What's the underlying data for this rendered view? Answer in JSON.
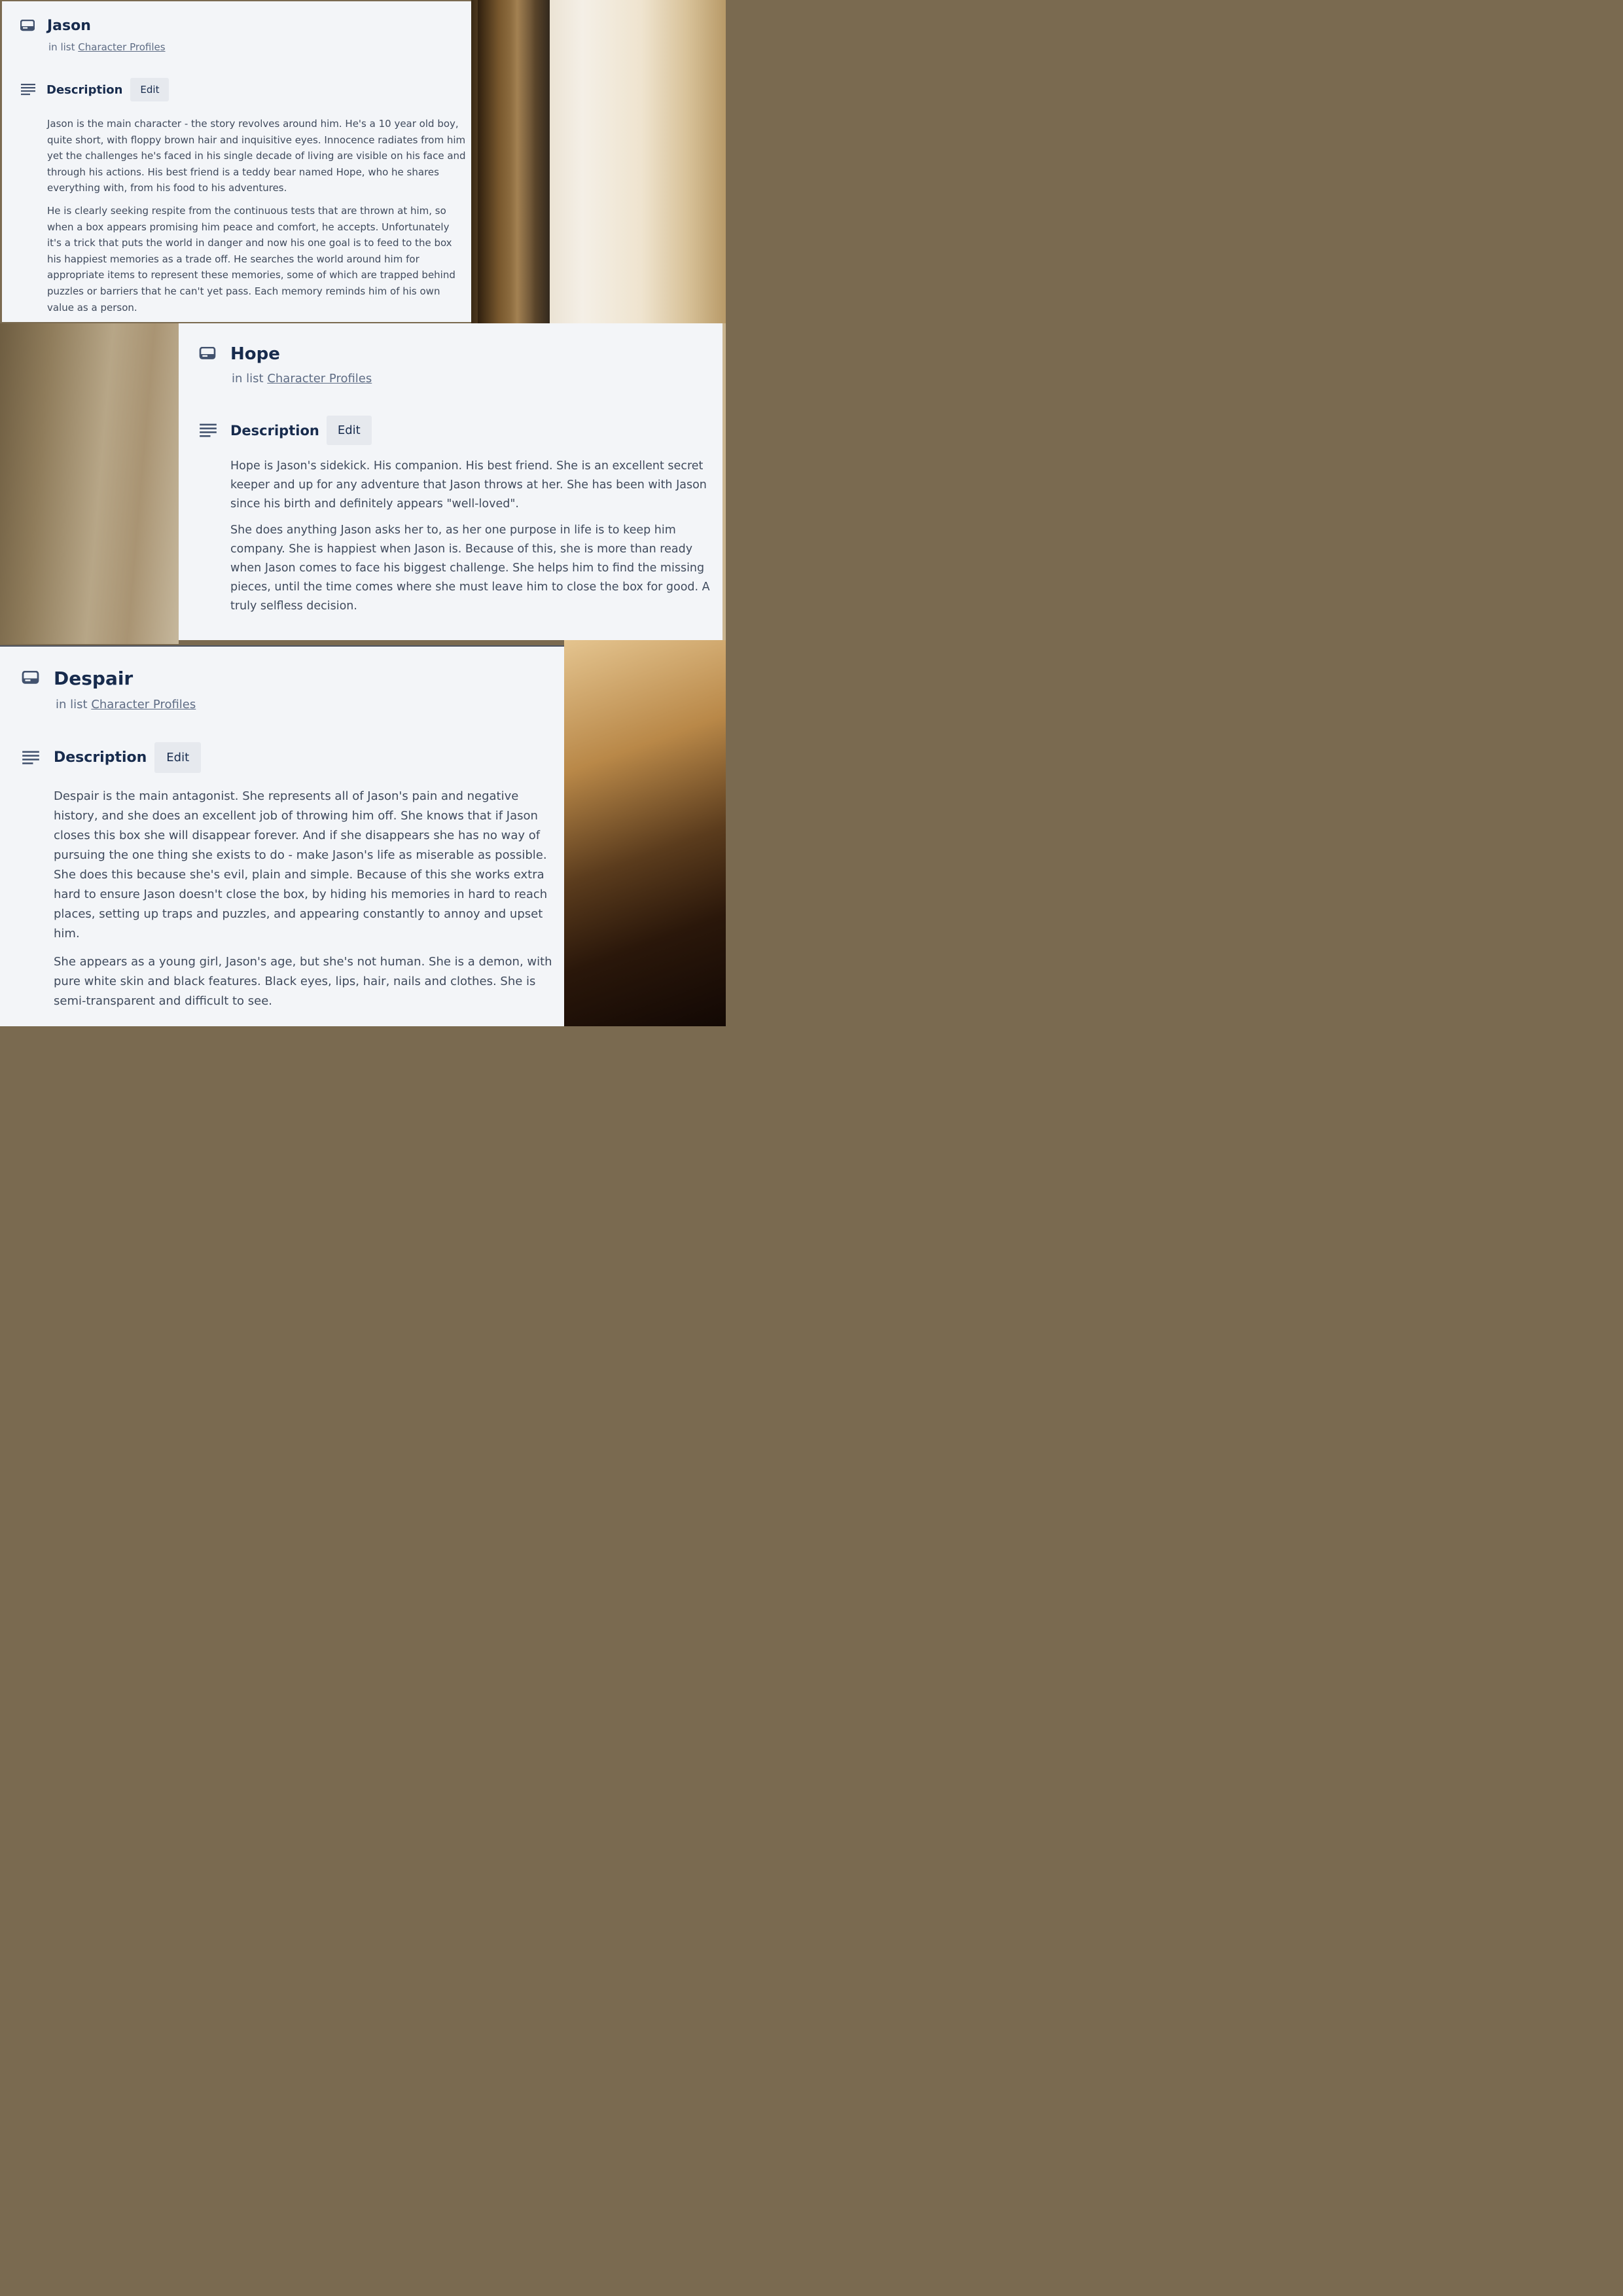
{
  "cards": [
    {
      "title": "Jason",
      "in_list_prefix": "in list",
      "list_name": "Character Profiles",
      "description_label": "Description",
      "edit_label": "Edit",
      "paragraphs": [
        "Jason is the main character - the story revolves around him. He's a 10 year old boy, quite short, with floppy brown hair and inquisitive eyes. Innocence radiates from him yet the challenges he's faced in his single decade of living are visible on his face and through his actions. His best friend is a teddy bear named Hope, who he shares everything with, from his food to his adventures.",
        "He is clearly seeking respite from the continuous tests that are thrown at him, so when a box appears promising him peace and comfort, he accepts. Unfortunately it's a trick that puts the world in danger and now his one goal is to feed to the box his happiest memories as a trade off. He searches the world around him for appropriate items to represent these memories, some of which are trapped behind puzzles or barriers that he can't yet pass. Each memory reminds him of his own value as a person."
      ]
    },
    {
      "title": "Hope",
      "in_list_prefix": "in list",
      "list_name": "Character Profiles",
      "description_label": "Description",
      "edit_label": "Edit",
      "paragraphs": [
        "Hope is Jason's sidekick. His companion. His best friend. She is an excellent secret keeper and up for any adventure that Jason throws at her. She has been with Jason since his birth and definitely appears \"well-loved\".",
        "She does anything Jason asks her to, as her one purpose in life is to keep him company. She is happiest when Jason is. Because of this, she is more than ready when Jason comes to face his biggest challenge. She helps him to find the missing pieces, until the time comes where she must leave him to close the box for good. A truly selfless decision."
      ]
    },
    {
      "title": "Despair",
      "in_list_prefix": "in list",
      "list_name": "Character Profiles",
      "description_label": "Description",
      "edit_label": "Edit",
      "paragraphs": [
        "Despair is the main antagonist. She represents all of Jason's pain and negative history, and she does an excellent job of throwing him off. She knows that if Jason closes this box she will disappear forever. And if she disappears she has no way of pursuing the one thing she exists to do - make Jason's life as miserable as possible. She does this because she's evil, plain and simple. Because of this she works extra hard to ensure Jason doesn't close the box, by hiding his memories in hard to reach places, setting up traps and puzzles, and appearing constantly to annoy and upset him.",
        "She appears as a young girl, Jason's age, but she's not human. She is a demon, with pure white skin and black features. Black eyes, lips, hair, nails and clothes. She is semi-transparent and difficult to see."
      ]
    }
  ],
  "icons": {
    "card": "card-icon",
    "description": "description-icon"
  }
}
